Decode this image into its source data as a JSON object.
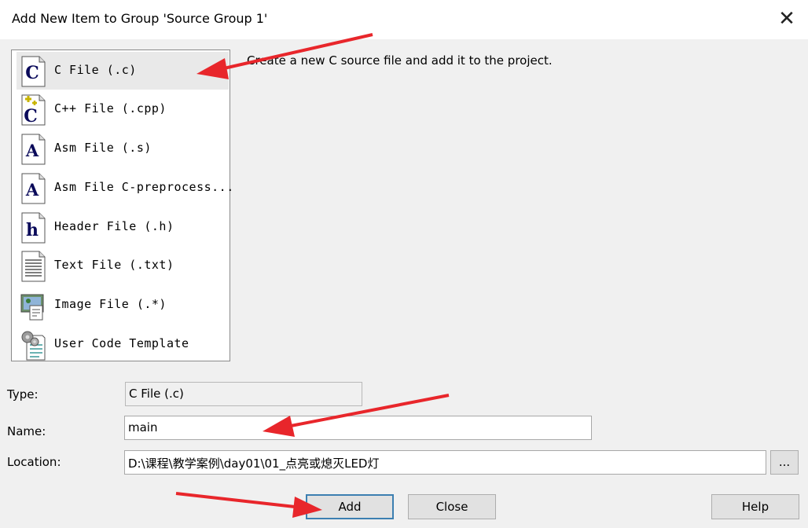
{
  "window": {
    "title": "Add New Item to Group 'Source Group 1'",
    "close_glyph": "✕"
  },
  "file_types": [
    {
      "label": "C File (.c)",
      "icon": "c-file-icon",
      "glyph": "C",
      "selected": true
    },
    {
      "label": "C++ File (.cpp)",
      "icon": "cpp-file-icon",
      "glyph": "C",
      "selected": false
    },
    {
      "label": "Asm File (.s)",
      "icon": "asm-file-icon",
      "glyph": "A",
      "selected": false
    },
    {
      "label": "Asm File C-preprocess...",
      "icon": "asm-preprocess-file-icon",
      "glyph": "A",
      "selected": false
    },
    {
      "label": "Header File (.h)",
      "icon": "header-file-icon",
      "glyph": "h",
      "selected": false
    },
    {
      "label": "Text File (.txt)",
      "icon": "text-file-icon",
      "glyph": "",
      "selected": false
    },
    {
      "label": "Image File (.*)",
      "icon": "image-file-icon",
      "glyph": "",
      "selected": false
    },
    {
      "label": "User Code Template",
      "icon": "user-code-template-icon",
      "glyph": "",
      "selected": false
    }
  ],
  "description": "Create a new C source file and add it to the project.",
  "form": {
    "type_label": "Type:",
    "type_value": "C File (.c)",
    "name_label": "Name:",
    "name_value": "main",
    "location_label": "Location:",
    "location_value": "D:\\课程\\教学案例\\day01\\01_点亮或熄灭LED灯",
    "browse_label": "..."
  },
  "buttons": {
    "add": "Add",
    "close": "Close",
    "help": "Help"
  },
  "colors": {
    "annotation_arrow": "#e8262b",
    "selection": "#e9e9e9",
    "icon_blue": "#0a0a5a"
  }
}
